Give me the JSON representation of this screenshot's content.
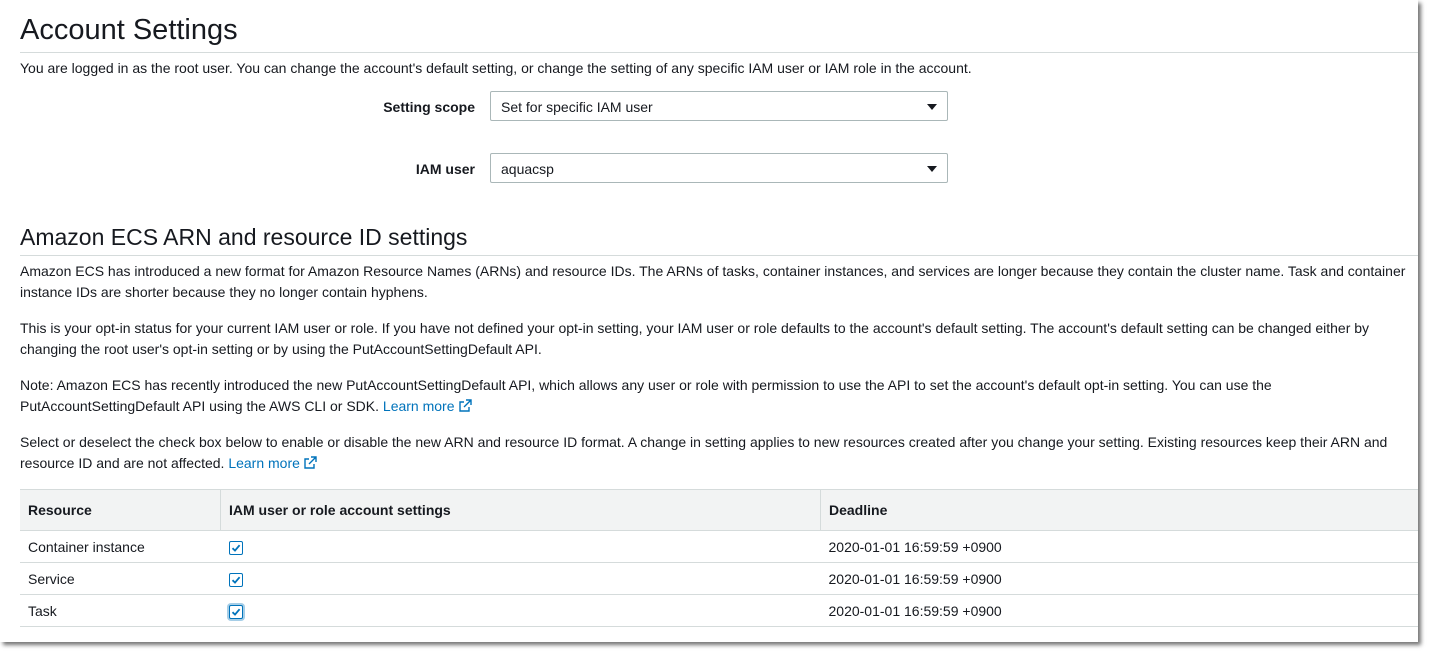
{
  "page": {
    "title": "Account Settings",
    "intro": "You are logged in as the root user. You can change the account's default setting, or change the setting of any specific IAM user or IAM role in the account."
  },
  "form": {
    "scope_label": "Setting scope",
    "scope_value": "Set for specific IAM user",
    "user_label": "IAM user",
    "user_value": "aquacsp"
  },
  "section": {
    "title": "Amazon ECS ARN and resource ID settings",
    "para1": "Amazon ECS has introduced a new format for Amazon Resource Names (ARNs) and resource IDs. The ARNs of tasks, container instances, and services are longer because they contain the cluster name. Task and container instance IDs are shorter because they no longer contain hyphens.",
    "para2": "This is your opt-in status for your current IAM user or role. If you have not defined your opt-in setting, your IAM user or role defaults to the account's default setting. The account's default setting can be changed either by changing the root user's opt-in setting or by using the PutAccountSettingDefault API.",
    "para3": "Note: Amazon ECS has recently introduced the new PutAccountSettingDefault API, which allows any user or role with permission to use the API to set the account's default opt-in setting. You can use the PutAccountSettingDefault API using the AWS CLI or SDK.",
    "para4": "Select or deselect the check box below to enable or disable the new ARN and resource ID format. A change in setting applies to new resources created after you change your setting. Existing resources keep their ARN and resource ID and are not affected.",
    "learn_more": "Learn more"
  },
  "table": {
    "headers": [
      "Resource",
      "IAM user or role account settings",
      "Deadline"
    ],
    "rows": [
      {
        "resource": "Container instance",
        "checked": true,
        "deadline": "2020-01-01 16:59:59 +0900"
      },
      {
        "resource": "Service",
        "checked": true,
        "deadline": "2020-01-01 16:59:59 +0900"
      },
      {
        "resource": "Task",
        "checked": true,
        "deadline": "2020-01-01 16:59:59 +0900"
      }
    ]
  },
  "colors": {
    "link": "#0073bb",
    "header_bg": "#f2f3f3",
    "border": "#d5dbdb"
  }
}
